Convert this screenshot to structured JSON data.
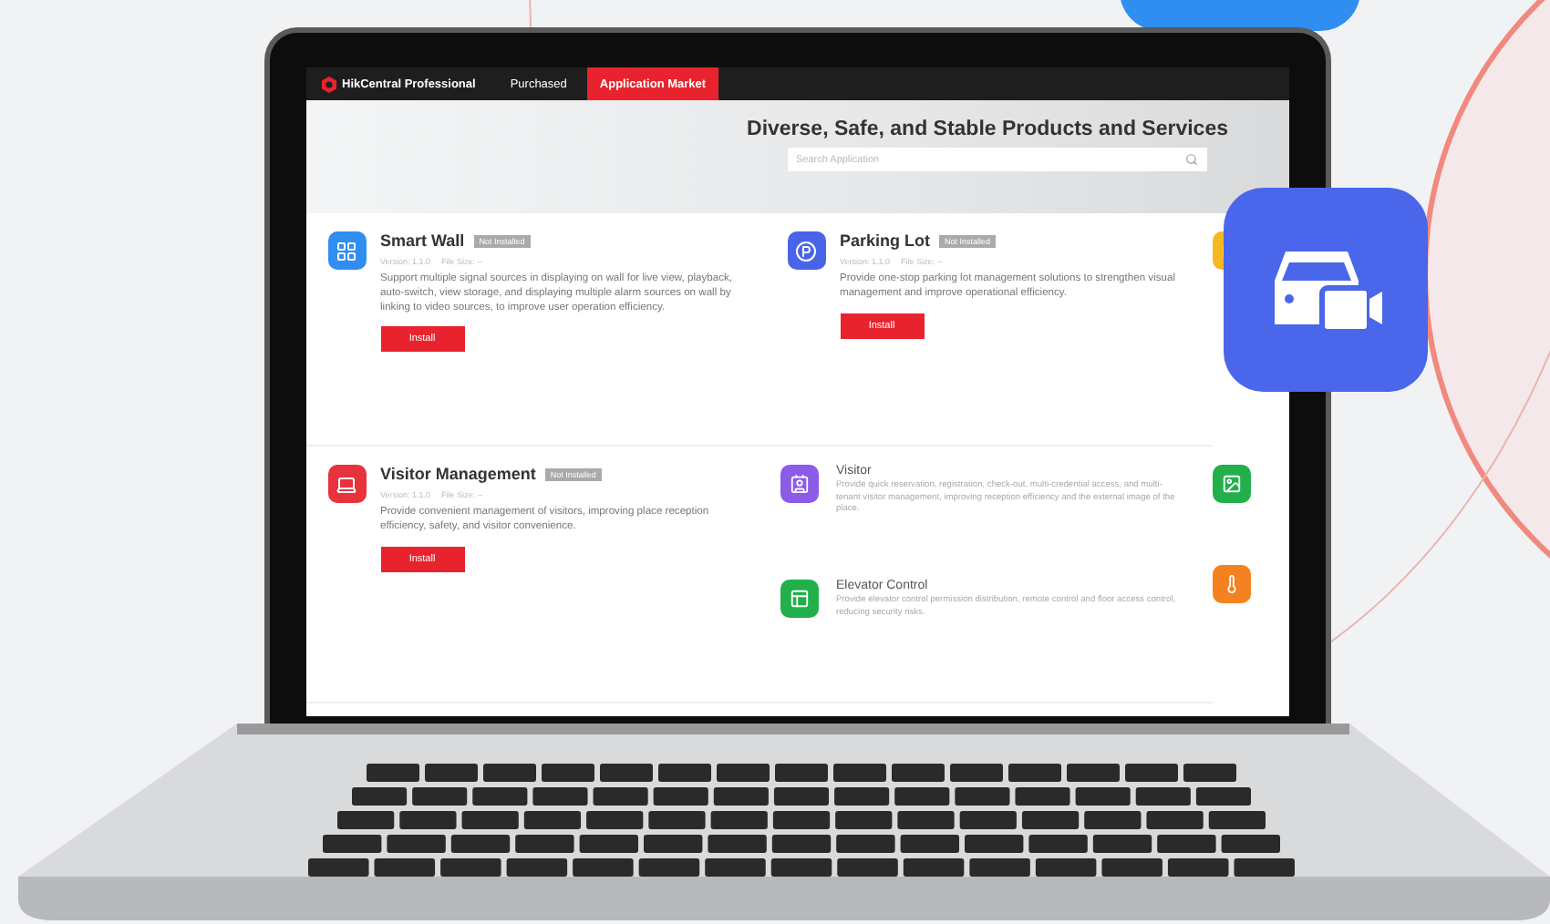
{
  "app": {
    "logo": "HikCentral Professional",
    "tabs": [
      {
        "label": "Purchased",
        "selected": false
      },
      {
        "label": "Application Market",
        "selected": true
      }
    ]
  },
  "banner": {
    "title": "Diverse, Safe, and Stable Products and Services",
    "search": {
      "placeholder": "Search Application"
    }
  },
  "featured": [
    {
      "name": "Smart Wall",
      "badge": "Not Installed",
      "version": "Version: 1.1.0",
      "file_size": "File Size: --",
      "description": "Support multiple signal sources in displaying on wall for live view, playback, auto-switch, view storage, and displaying multiple alarm sources on wall by linking to video sources, to improve user operation efficiency.",
      "button": "Install",
      "color": "#2f8ef0"
    },
    {
      "name": "Parking Lot",
      "badge": "Not Installed",
      "version": "Version: 1.1.0",
      "file_size": "File Size: --",
      "description": "Provide one-stop parking lot management solutions to strengthen visual management and improve operational efficiency.",
      "button": "Install",
      "color": "#4a64e8"
    },
    {
      "name": "Visitor Management",
      "badge": "Not Installed",
      "version": "Version: 1.1.0",
      "file_size": "File Size: --",
      "description": "Provide convenient management of visitors, improving place reception efficiency, safety, and visitor convenience.",
      "button": "Install",
      "color": "#e8323c"
    }
  ],
  "modules": [
    {
      "name": "Visitor",
      "description": "Provide quick reservation, registration, check-out, multi-credential access, and multi-tenant visitor management, improving reception efficiency and the external image of the place.",
      "color": "#8a5ce8"
    },
    {
      "name": "Elevator Control",
      "description": "Provide elevator control permission distribution, remote control and floor access control, reducing security risks.",
      "color": "#22b04b"
    }
  ],
  "cut_apps": [
    {
      "color": "#f5b820"
    },
    {
      "color": "#22b04b"
    },
    {
      "color": "#f58220"
    }
  ]
}
